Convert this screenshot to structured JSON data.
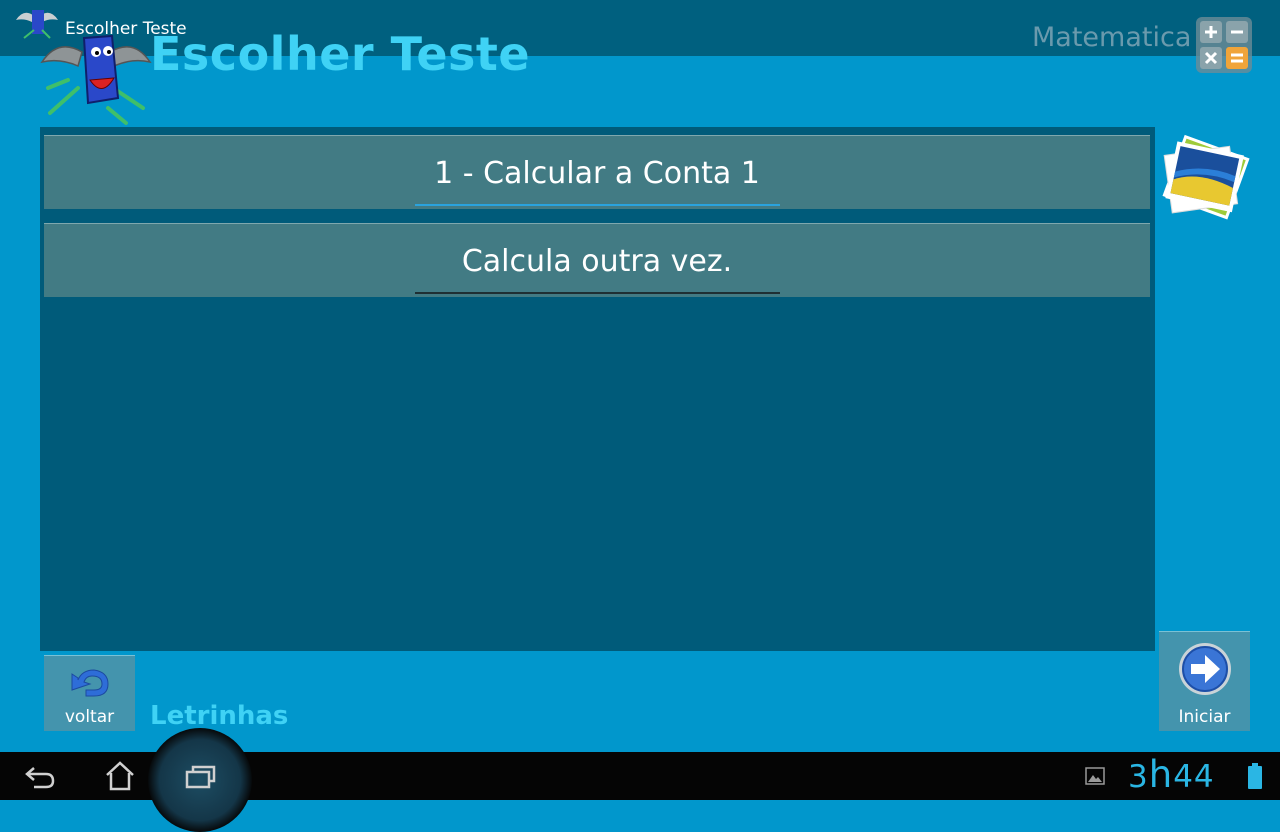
{
  "app": {
    "window_title": "Escolher Teste",
    "header_title": "Escolher Teste",
    "subject": "Matematica"
  },
  "tests": {
    "items": [
      {
        "label": "1 - Calcular a Conta 1",
        "selected": true
      },
      {
        "label": "Calcula outra vez.",
        "selected": false
      }
    ]
  },
  "footer": {
    "back_label": "voltar",
    "category": "Letrinhas",
    "start_label": "Iniciar"
  },
  "statusbar": {
    "time_hour": "3",
    "time_sep": "h",
    "time_min": "44"
  },
  "colors": {
    "background": "#0197cc",
    "panel": "#005b7a",
    "row": "#427b84",
    "accent": "#3fd2f5",
    "selected_underline": "#2aa3dd"
  },
  "icons": {
    "mascot": "mascot-logo",
    "calculator": "calculator-icon",
    "gallery": "photo-gallery-icon",
    "back": "undo-arrow-icon",
    "start": "forward-arrow-icon"
  }
}
